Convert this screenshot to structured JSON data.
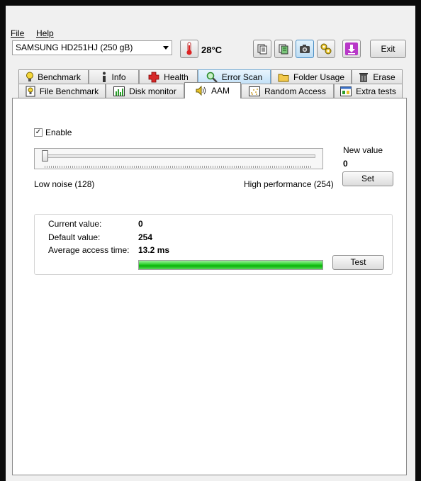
{
  "menu": {
    "file": "File",
    "help": "Help"
  },
  "toolbar": {
    "drive": "SAMSUNG HD251HJ (250 gB)",
    "temperature": "28°C",
    "exit_label": "Exit",
    "buttons": [
      "copy-text-icon",
      "copy-all-icon",
      "camera-icon",
      "options-icon",
      "save-down-icon"
    ]
  },
  "tabs_row1": [
    {
      "label": "Benchmark",
      "icon": "lightbulb-icon"
    },
    {
      "label": "Info",
      "icon": "info-icon"
    },
    {
      "label": "Health",
      "icon": "health-cross-icon"
    },
    {
      "label": "Error Scan",
      "icon": "magnifier-icon"
    },
    {
      "label": "Folder Usage",
      "icon": "folder-icon"
    },
    {
      "label": "Erase",
      "icon": "trash-icon"
    }
  ],
  "tabs_row2": [
    {
      "label": "File Benchmark",
      "icon": "file-benchmark-icon"
    },
    {
      "label": "Disk monitor",
      "icon": "chart-icon"
    },
    {
      "label": "AAM",
      "icon": "speaker-icon"
    },
    {
      "label": "Random Access",
      "icon": "random-access-icon"
    },
    {
      "label": "Extra tests",
      "icon": "extra-tests-icon"
    }
  ],
  "aam": {
    "enable_label": "Enable",
    "enabled": true,
    "new_value_label": "New value",
    "new_value": "0",
    "set_label": "Set",
    "low_label": "Low noise (128)",
    "high_label": "High performance (254)",
    "slider_level": 0,
    "current_label": "Current value:",
    "current_value": "0",
    "default_label": "Default value:",
    "default_value": "254",
    "avg_label": "Average access time:",
    "avg_value": "13.2 ms",
    "progress_percent": 100,
    "test_label": "Test"
  },
  "colors": {
    "accent_tab": "#c4e2f8",
    "progress": "#06b406"
  }
}
